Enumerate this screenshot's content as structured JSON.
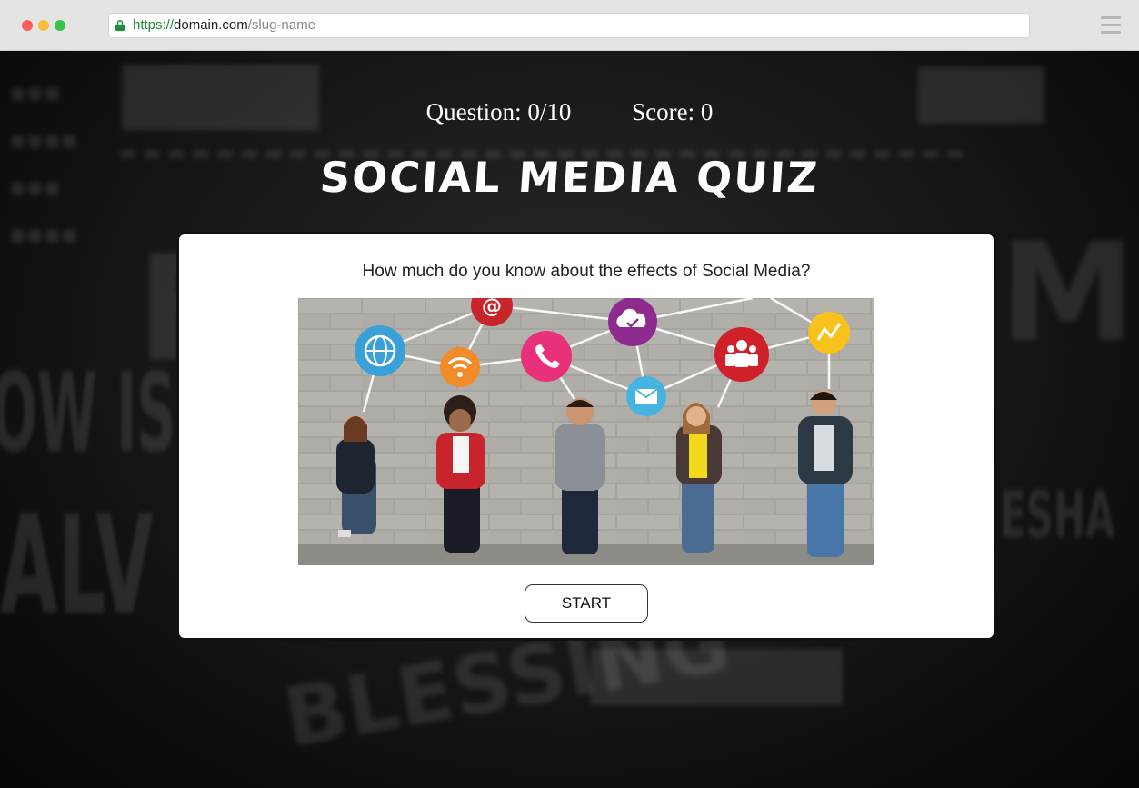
{
  "browser": {
    "url_scheme": "https://",
    "url_domain": "domain.com",
    "url_path": "/slug-name"
  },
  "quiz": {
    "question_label": "Question: 0/10",
    "score_label": "Score: 0",
    "title": "SOCIAL MEDIA QUIZ",
    "prompt": "How much do you know about the effects of Social Media?",
    "start_label": "START"
  },
  "image": {
    "icons": [
      "globe-icon",
      "wifi-icon",
      "at-sign-icon",
      "phone-icon",
      "cloud-icon",
      "mail-icon",
      "people-icon",
      "chart-icon"
    ],
    "colors": {
      "globe": "#3aa0d8",
      "wifi": "#f28b2a",
      "at": "#c8252b",
      "phone": "#e8317a",
      "cloud": "#8e2b8f",
      "mail": "#45b4e0",
      "people": "#d0202a",
      "chart": "#f7c21c"
    }
  },
  "colors": {
    "chrome_bg": "#e4e4e4",
    "page_bg": "#151515",
    "card_bg": "#ffffff",
    "secure_green": "#1f8f3a"
  }
}
